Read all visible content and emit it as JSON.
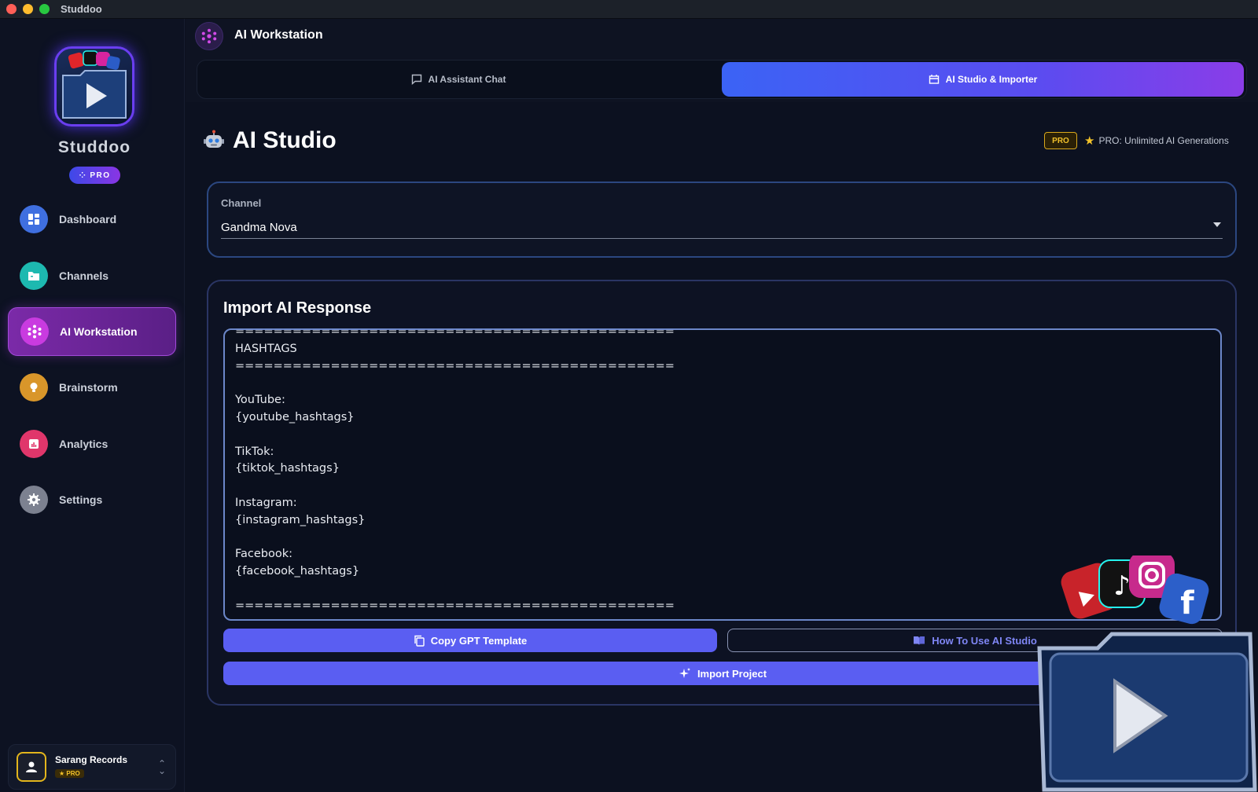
{
  "window": {
    "title": "Studdoo"
  },
  "sidebar": {
    "brand_name": "Studdoo",
    "brand_badge": "PRO",
    "items": [
      {
        "label": "Dashboard",
        "icon": "dashboard-icon",
        "color": "#3f6fe0"
      },
      {
        "label": "Channels",
        "icon": "folder-icon",
        "color": "#1db9b0"
      },
      {
        "label": "AI Workstation",
        "icon": "ai-workstation-icon",
        "color": "#c93be0",
        "active": true
      },
      {
        "label": "Brainstorm",
        "icon": "lightbulb-icon",
        "color": "#d9962a"
      },
      {
        "label": "Analytics",
        "icon": "chart-icon",
        "color": "#e0366b"
      },
      {
        "label": "Settings",
        "icon": "gear-icon",
        "color": "#7c8190"
      }
    ],
    "user": {
      "name": "Sarang Records",
      "badge": "★ PRO"
    }
  },
  "header": {
    "title": "AI Workstation",
    "tabs": [
      {
        "label": "AI Assistant Chat",
        "icon": "chat-icon"
      },
      {
        "label": "AI Studio & Importer",
        "icon": "studio-icon",
        "active": true
      }
    ]
  },
  "studio": {
    "title": "AI Studio",
    "pro_chip": "PRO",
    "pro_note": "PRO: Unlimited AI Generations",
    "channel": {
      "label": "Channel",
      "value": "Gandma Nova"
    },
    "import": {
      "title": "Import AI Response",
      "text": "==============================================\nHASHTAGS\n==============================================\n\nYouTube:\n{youtube_hashtags}\n\nTikTok:\n{tiktok_hashtags}\n\nInstagram:\n{instagram_hashtags}\n\nFacebook:\n{facebook_hashtags}\n\n==============================================",
      "copy_button": "Copy GPT Template",
      "howto_button": "How To Use AI Studio",
      "import_button": "Import Project"
    }
  },
  "colors": {
    "accent": "#5a5ef2",
    "active_nav": "#7b2aa8",
    "pro_gold": "#f0c02c"
  }
}
